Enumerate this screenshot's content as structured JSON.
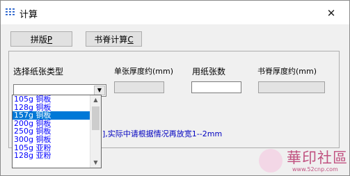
{
  "window": {
    "title": "计算",
    "close_glyph": "✕"
  },
  "toolbar": {
    "typeset_label": "拼版",
    "typeset_key": "P",
    "spine_label": "书脊计算",
    "spine_key": "C"
  },
  "form": {
    "paper_type_label": "选择纸张类型",
    "sheet_thickness_label": "单张厚度约(mm)",
    "sheet_count_label": "用纸张数",
    "spine_thickness_label": "书脊厚度约(mm)",
    "sheet_count_value": ""
  },
  "note": "],实际中请根据情况再放宽1--2mm",
  "dropdown": {
    "items": [
      "105g 铜板",
      "128g 铜板",
      "157g 铜板",
      "200g 铜板",
      "250g 铜板",
      "300g 铜板",
      "105g 亚粉",
      "128g 亚粉"
    ],
    "selected_index": 2
  },
  "watermark": {
    "text": "華印社區",
    "url": "www.52cnp.com"
  },
  "colors": {
    "accent": "#0078d7",
    "link": "#0000ff",
    "note": "#0000c0"
  }
}
